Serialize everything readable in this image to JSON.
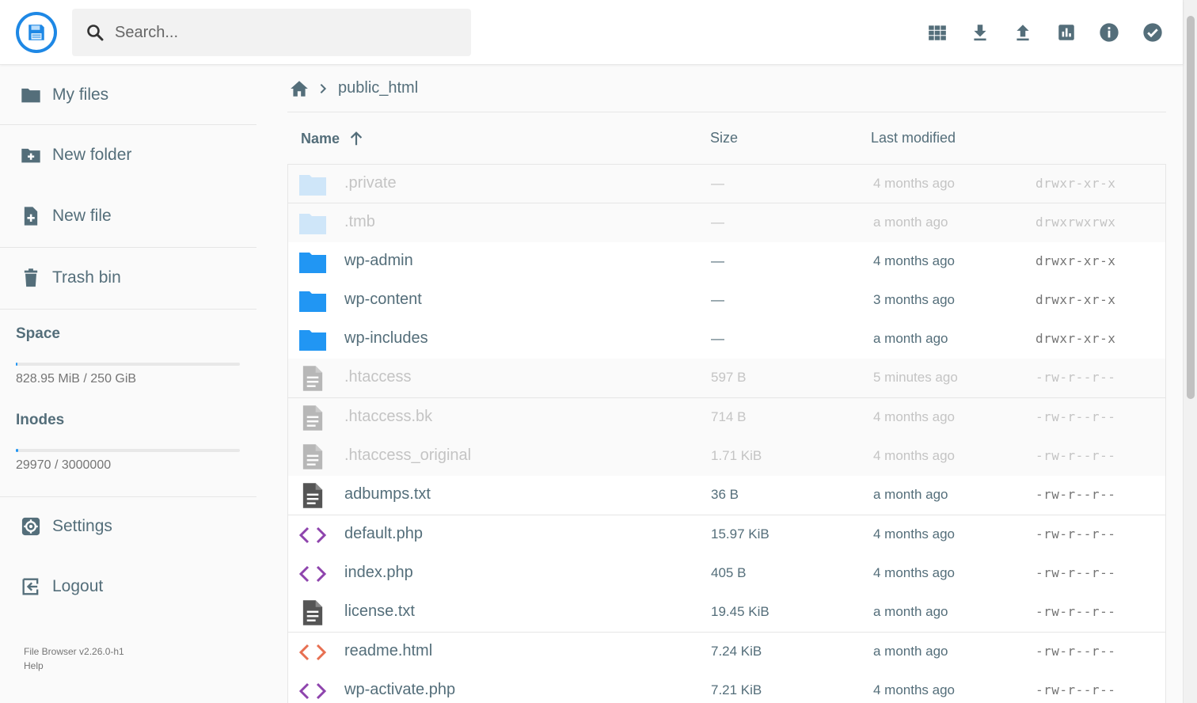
{
  "header": {
    "search_placeholder": "Search...",
    "actions": [
      "grid-view",
      "download",
      "upload",
      "disk-usage",
      "info",
      "select"
    ]
  },
  "sidebar": {
    "items": [
      {
        "label": "My files",
        "icon": "folder-icon"
      },
      {
        "label": "New folder",
        "icon": "folder-plus-icon"
      },
      {
        "label": "New file",
        "icon": "file-plus-icon"
      },
      {
        "label": "Trash bin",
        "icon": "trash-icon"
      }
    ],
    "space": {
      "title": "Space",
      "value": "828.95 MiB / 250 GiB",
      "fraction": 0.0032
    },
    "inodes": {
      "title": "Inodes",
      "value": "29970 / 3000000",
      "fraction": 0.01
    },
    "settings_label": "Settings",
    "logout_label": "Logout",
    "version": "File Browser v2.26.0-h1",
    "help": "Help"
  },
  "breadcrumb": {
    "current": "public_html"
  },
  "list": {
    "headers": {
      "name": "Name",
      "size": "Size",
      "modified": "Last modified"
    },
    "rows": [
      {
        "name": ".private",
        "size": "—",
        "modified": "4 months ago",
        "perm": "drwxr-xr-x",
        "type": "folder",
        "hidden": true
      },
      {
        "name": ".tmb",
        "size": "—",
        "modified": "a month ago",
        "perm": "drwxrwxrwx",
        "type": "folder",
        "hidden": true
      },
      {
        "name": "wp-admin",
        "size": "—",
        "modified": "4 months ago",
        "perm": "drwxr-xr-x",
        "type": "folder",
        "hidden": false
      },
      {
        "name": "wp-content",
        "size": "—",
        "modified": "3 months ago",
        "perm": "drwxr-xr-x",
        "type": "folder",
        "hidden": false
      },
      {
        "name": "wp-includes",
        "size": "—",
        "modified": "a month ago",
        "perm": "drwxr-xr-x",
        "type": "folder",
        "hidden": false
      },
      {
        "name": ".htaccess",
        "size": "597 B",
        "modified": "5 minutes ago",
        "perm": "-rw-r--r--",
        "type": "text",
        "hidden": true
      },
      {
        "name": ".htaccess.bk",
        "size": "714 B",
        "modified": "4 months ago",
        "perm": "-rw-r--r--",
        "type": "text",
        "hidden": true
      },
      {
        "name": ".htaccess_original",
        "size": "1.71 KiB",
        "modified": "4 months ago",
        "perm": "-rw-r--r--",
        "type": "text",
        "hidden": true
      },
      {
        "name": "adbumps.txt",
        "size": "36 B",
        "modified": "a month ago",
        "perm": "-rw-r--r--",
        "type": "text",
        "hidden": false
      },
      {
        "name": "default.php",
        "size": "15.97 KiB",
        "modified": "4 months ago",
        "perm": "-rw-r--r--",
        "type": "php",
        "hidden": false
      },
      {
        "name": "index.php",
        "size": "405 B",
        "modified": "4 months ago",
        "perm": "-rw-r--r--",
        "type": "php",
        "hidden": false
      },
      {
        "name": "license.txt",
        "size": "19.45 KiB",
        "modified": "a month ago",
        "perm": "-rw-r--r--",
        "type": "text",
        "hidden": false
      },
      {
        "name": "readme.html",
        "size": "7.24 KiB",
        "modified": "a month ago",
        "perm": "-rw-r--r--",
        "type": "html",
        "hidden": false
      },
      {
        "name": "wp-activate.php",
        "size": "7.21 KiB",
        "modified": "4 months ago",
        "perm": "-rw-r--r--",
        "type": "php",
        "hidden": false
      }
    ]
  },
  "colors": {
    "accent": "#2196f3",
    "folder": "#2196f3",
    "folder_hidden": "#90caf9",
    "php": "#8e44ad",
    "html": "#e76f51",
    "text_icon": "#555555",
    "sidebar_text": "#546e7a"
  }
}
